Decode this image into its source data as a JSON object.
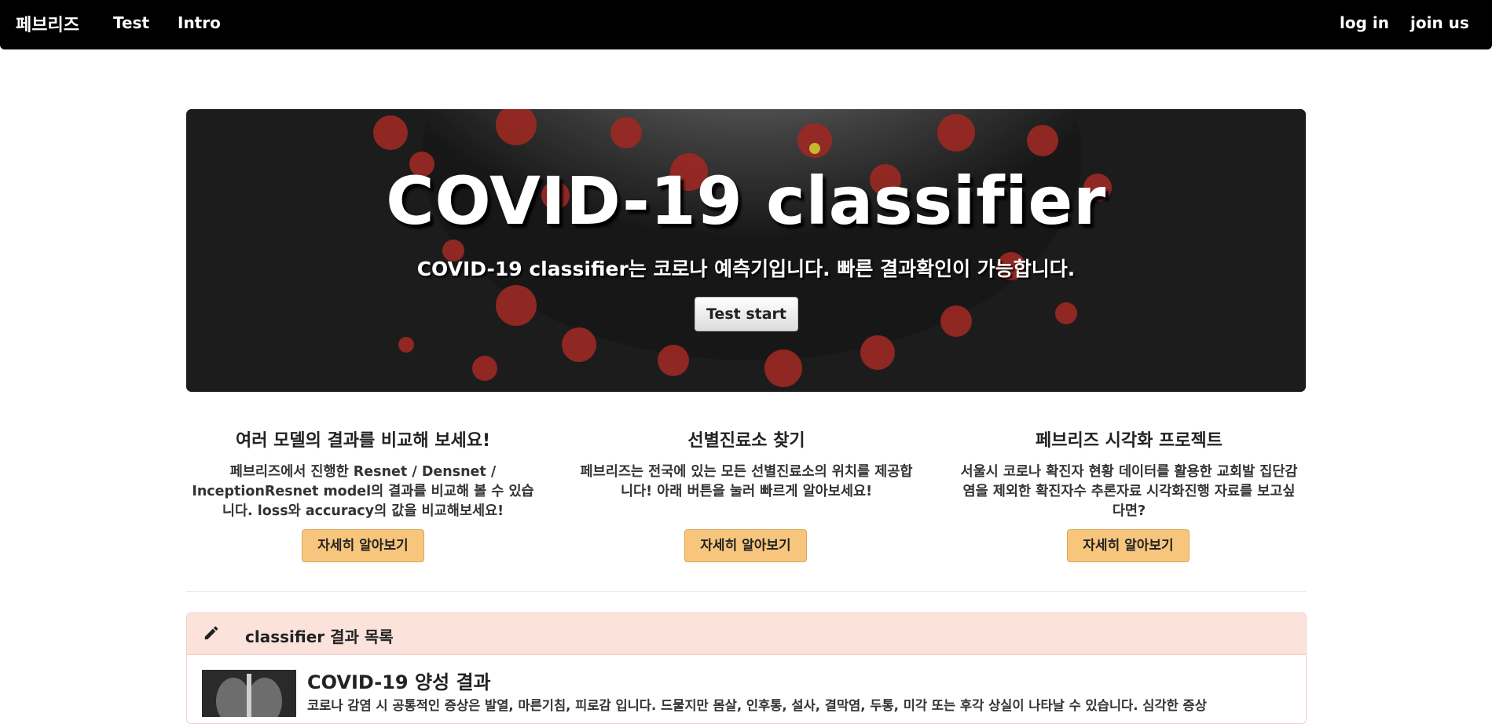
{
  "nav": {
    "brand": "페브리즈",
    "links": [
      "Test",
      "Intro"
    ],
    "login": "log in",
    "join": "join us"
  },
  "hero": {
    "title": "COVID-19 classifier",
    "subtitle": "COVID-19 classifier는 코로나 예측기입니다. 빠른 결과확인이 가능합니다.",
    "button": "Test start"
  },
  "features": [
    {
      "title": "여러 모델의 결과를 비교해 보세요!",
      "lines": [
        "페브리즈에서 진행한 Resnet / Densnet /",
        "InceptionResnet model의 결과를 비교해 볼 수 있습",
        "니다. loss와 accuracy의 값을 비교해보세요!"
      ],
      "button": "자세히 알아보기"
    },
    {
      "title": "선별진료소 찾기",
      "lines": [
        "페브리즈는 전국에 있는 모든 선별진료소의 위치를 제공합",
        "니다! 아래 버튼을 눌러 빠르게 알아보세요!"
      ],
      "button": "자세히 알아보기"
    },
    {
      "title": "페브리즈 시각화 프로젝트",
      "lines": [
        "서울시 코로나 확진자 현황 데이터를 활용한 교회발 집단감",
        "염을 제외한 확진자수 추론자료 시각화진행 자료를 보고싶",
        "다면?"
      ],
      "button": "자세히 알아보기"
    }
  ],
  "results": {
    "header": "classifier 결과 목록",
    "item_title": "COVID-19 양성 결과",
    "item_text": "코로나 감염 시 공통적인 증상은 발열, 마른기침, 피로감 입니다. 드물지만 몸살, 인후통, 설사, 결막염, 두통, 미각 또는 후각 상실이 나타날 수 있습니다. 심각한 증상"
  },
  "colors": {
    "navbar": "#000000",
    "accent_button": "#f7c67c",
    "panel_header": "#fbe3dc"
  }
}
